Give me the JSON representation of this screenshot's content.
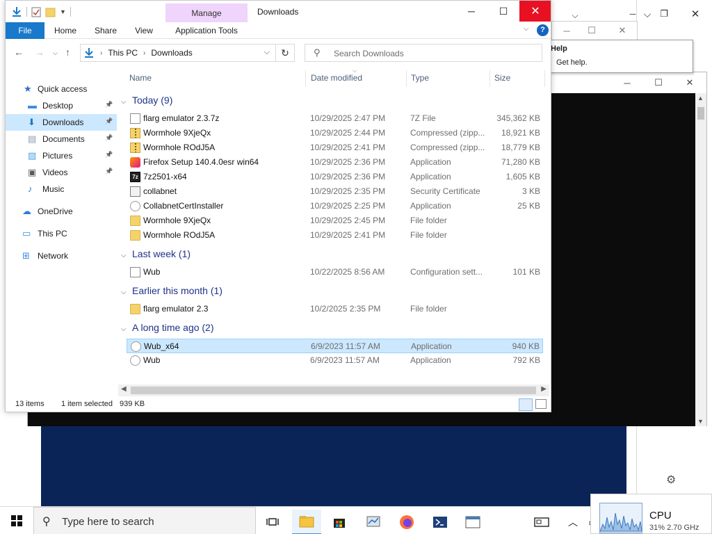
{
  "background": {
    "help_window": {
      "tooltip_title": "Help",
      "tooltip_text": "Get help."
    }
  },
  "explorer": {
    "title": "Downloads",
    "context_tab": "Manage",
    "ribbon_tabs": [
      "File",
      "Home",
      "Share",
      "View",
      "Application Tools"
    ],
    "address": {
      "crumb_1": "This PC",
      "crumb_2": "Downloads"
    },
    "search_placeholder": "Search Downloads",
    "columns": {
      "name": "Name",
      "date": "Date modified",
      "type": "Type",
      "size": "Size"
    },
    "sidebar": [
      {
        "label": "Quick access",
        "icon": "star-icon",
        "pinned": false
      },
      {
        "label": "Desktop",
        "icon": "desktop-icon",
        "pinned": true
      },
      {
        "label": "Downloads",
        "icon": "download-icon",
        "pinned": true,
        "selected": true
      },
      {
        "label": "Documents",
        "icon": "documents-icon",
        "pinned": true
      },
      {
        "label": "Pictures",
        "icon": "pictures-icon",
        "pinned": true
      },
      {
        "label": "Videos",
        "icon": "videos-icon",
        "pinned": true
      },
      {
        "label": "Music",
        "icon": "music-icon",
        "pinned": false
      },
      {
        "label": "OneDrive",
        "icon": "cloud-icon",
        "pinned": false
      },
      {
        "label": "This PC",
        "icon": "computer-icon",
        "pinned": false
      },
      {
        "label": "Network",
        "icon": "network-icon",
        "pinned": false
      }
    ],
    "groups": [
      {
        "label": "Today (9)",
        "rows": [
          {
            "name": "flarg emulator 2.3.7z",
            "date": "10/29/2025 2:47 PM",
            "type": "7Z File",
            "size": "345,362 KB",
            "icon": "file-icon"
          },
          {
            "name": "Wormhole 9XjeQx",
            "date": "10/29/2025 2:44 PM",
            "type": "Compressed (zipp...",
            "size": "18,921 KB",
            "icon": "zip-icon"
          },
          {
            "name": "Wormhole ROdJ5A",
            "date": "10/29/2025 2:41 PM",
            "type": "Compressed (zipp...",
            "size": "18,779 KB",
            "icon": "zip-icon"
          },
          {
            "name": "Firefox Setup 140.4.0esr win64",
            "date": "10/29/2025 2:36 PM",
            "type": "Application",
            "size": "71,280 KB",
            "icon": "firefox-icon"
          },
          {
            "name": "7z2501-x64",
            "date": "10/29/2025 2:36 PM",
            "type": "Application",
            "size": "1,605 KB",
            "icon": "7zip-icon"
          },
          {
            "name": "collabnet",
            "date": "10/29/2025 2:35 PM",
            "type": "Security Certificate",
            "size": "3 KB",
            "icon": "certificate-icon"
          },
          {
            "name": "CollabnetCertInstaller",
            "date": "10/29/2025 2:25 PM",
            "type": "Application",
            "size": "25 KB",
            "icon": "app-icon"
          },
          {
            "name": "Wormhole 9XjeQx",
            "date": "10/29/2025 2:45 PM",
            "type": "File folder",
            "size": "",
            "icon": "folder-icon"
          },
          {
            "name": "Wormhole ROdJ5A",
            "date": "10/29/2025 2:41 PM",
            "type": "File folder",
            "size": "",
            "icon": "folder-icon"
          }
        ]
      },
      {
        "label": "Last week (1)",
        "rows": [
          {
            "name": "Wub",
            "date": "10/22/2025 8:56 AM",
            "type": "Configuration sett...",
            "size": "101 KB",
            "icon": "config-icon"
          }
        ]
      },
      {
        "label": "Earlier this month (1)",
        "rows": [
          {
            "name": "flarg emulator 2.3",
            "date": "10/2/2025 2:35 PM",
            "type": "File folder",
            "size": "",
            "icon": "folder-icon"
          }
        ]
      },
      {
        "label": "A long time ago (2)",
        "rows": [
          {
            "name": "Wub_x64",
            "date": "6/9/2023 11:57 AM",
            "type": "Application",
            "size": "940 KB",
            "icon": "app-icon",
            "selected": true
          },
          {
            "name": "Wub",
            "date": "6/9/2023 11:57 AM",
            "type": "Application",
            "size": "792 KB",
            "icon": "app-icon"
          }
        ]
      }
    ],
    "status": {
      "count": "13 items",
      "selected": "1 item selected",
      "size": "939 KB"
    }
  },
  "taskbar": {
    "search_placeholder": "Type here to search",
    "cpu_title": "CPU",
    "cpu_detail": "31% 2.70 GHz"
  },
  "colors": {
    "accent": "#1979ca",
    "close": "#e81123",
    "selection": "#cce8ff",
    "manage_tab": "#efd4fb"
  }
}
